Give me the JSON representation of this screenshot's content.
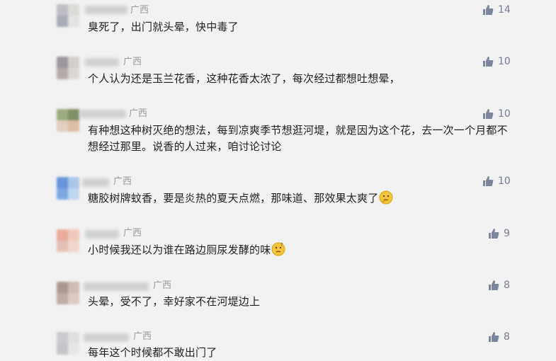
{
  "comments": [
    {
      "region": "广西",
      "text": "臭死了，出门就头晕，快中毒了",
      "likes": "14",
      "avatar_colors": [
        "#b6b6bf",
        "#d9d6d2",
        "#9aa0ab",
        "#e3e1df"
      ]
    },
    {
      "region": "广西",
      "text": "个人认为还是玉兰花香，这种花香太浓了，每次经过都想吐想晕，",
      "likes": "10",
      "avatar_colors": [
        "#8d8791",
        "#cfc8c3",
        "#a79e9a",
        "#d8d2cd"
      ]
    },
    {
      "region": "广西",
      "text": "有种想这种树灭绝的想法，每到凉爽季节想逛河堤，就是因为这个花，去一次一个月都不想经过那里。说香的人过来，咱讨论讨论",
      "likes": "10",
      "avatar_colors": [
        "#8fa06b",
        "#6c7f4a",
        "#e0c9b5",
        "#d9b49c"
      ]
    },
    {
      "region": "广西",
      "text": "糖胶树牌蚊香，要是炎热的夏天点燃，那味道、那效果太爽了",
      "likes": "10",
      "avatar_colors": [
        "#4f86d6",
        "#9fc0e6",
        "#6a9be0",
        "#b9d2ef"
      ],
      "emoji": "thinking-emoji"
    },
    {
      "region": "广西",
      "text": "小时候我还以为谁在路边厕尿发酵的味",
      "likes": "9",
      "avatar_colors": [
        "#e9a08f",
        "#f1c2b3",
        "#e4b8aa",
        "#efd2c8"
      ],
      "emoji": "confused-emoji"
    },
    {
      "region": "广西",
      "text": "头晕，受不了，幸好家不在河堤边上",
      "likes": "8",
      "avatar_colors": [
        "#9d8a80",
        "#c7b4a8",
        "#b7a096",
        "#d6c5bb"
      ]
    },
    {
      "region": "广西",
      "text": "每年这个时候都不敢出门了",
      "likes": "8",
      "avatar_colors": [
        "#c4c4c8",
        "#dcdcdf",
        "#bdbdc2",
        "#e6e6e8"
      ]
    }
  ],
  "colors": {
    "background": "#f2f2f2",
    "like_icon": "#7b859b",
    "region_text": "#9a9a9a"
  }
}
